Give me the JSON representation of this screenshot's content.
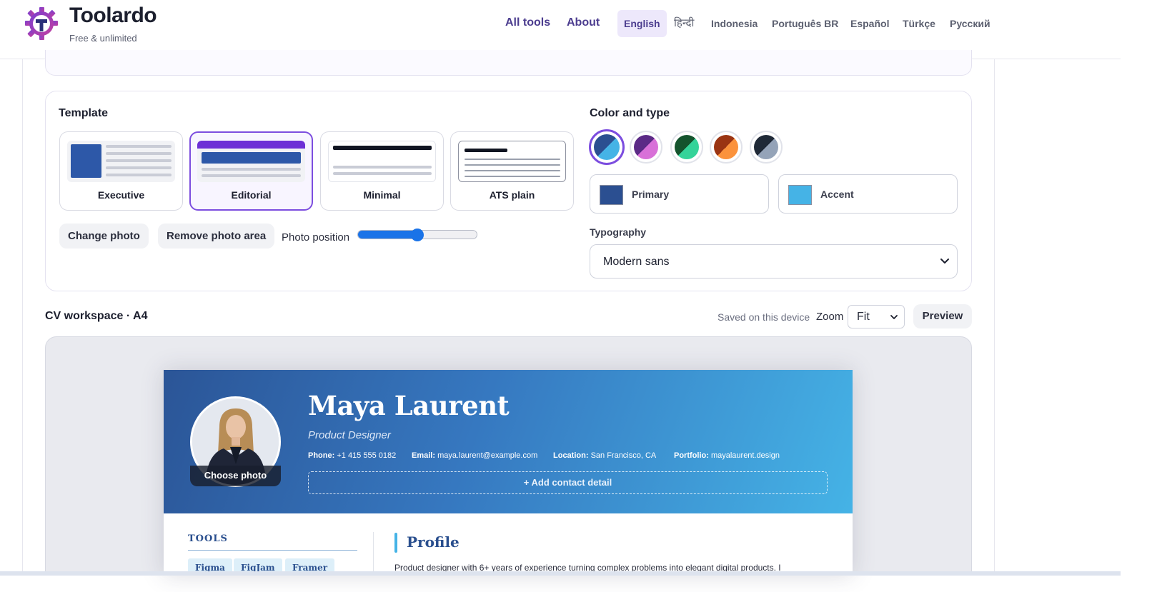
{
  "header": {
    "brand_name": "Toolardo",
    "brand_tagline": "Free & unlimited",
    "nav": [
      "All tools",
      "About"
    ],
    "languages": [
      "English",
      "हिन्दी",
      "Indonesia",
      "Português BR",
      "Español",
      "Türkçe",
      "Русский"
    ],
    "active_language": "English"
  },
  "settings": {
    "template_title": "Template",
    "templates": [
      "Executive",
      "Editorial",
      "Minimal",
      "ATS plain"
    ],
    "selected_template": "Editorial",
    "change_photo": "Change photo",
    "remove_photo_area": "Remove photo area",
    "photo_position_label": "Photo position",
    "photo_position_value": 0.5,
    "color_title": "Color and type",
    "palettes": [
      {
        "primary": "#2b4f91",
        "accent": "#45b3e6",
        "selected": true
      },
      {
        "primary": "#5b2a86",
        "accent": "#d870d8",
        "selected": false
      },
      {
        "primary": "#14532d",
        "accent": "#34d399",
        "selected": false
      },
      {
        "primary": "#9a3412",
        "accent": "#fb923c",
        "selected": false
      },
      {
        "primary": "#1f2937",
        "accent": "#94a3b8",
        "selected": false
      }
    ],
    "primary_label": "Primary",
    "primary_color": "#2b4f91",
    "accent_label": "Accent",
    "accent_color": "#45b3e6",
    "typography_label": "Typography",
    "typography_value": "Modern sans"
  },
  "workspace": {
    "title": "CV workspace · A4",
    "saved_status": "Saved on this device",
    "zoom_label": "Zoom",
    "zoom_value": "Fit",
    "preview_button": "Preview"
  },
  "cv": {
    "name": "Maya Laurent",
    "role": "Product Designer",
    "choose_photo": "Choose photo",
    "contacts": [
      {
        "label": "Phone:",
        "value": "+1 415 555 0182"
      },
      {
        "label": "Email:",
        "value": "maya.laurent@example.com"
      },
      {
        "label": "Location:",
        "value": "San Francisco, CA"
      },
      {
        "label": "Portfolio:",
        "value": "mayalaurent.design"
      }
    ],
    "add_contact": "+ Add contact detail",
    "tools_title": "TOOLS",
    "tools": [
      "Figma",
      "FigJam",
      "Framer"
    ],
    "profile_title": "Profile",
    "profile_text": "Product designer with 6+ years of experience turning complex problems into elegant digital products. I"
  }
}
